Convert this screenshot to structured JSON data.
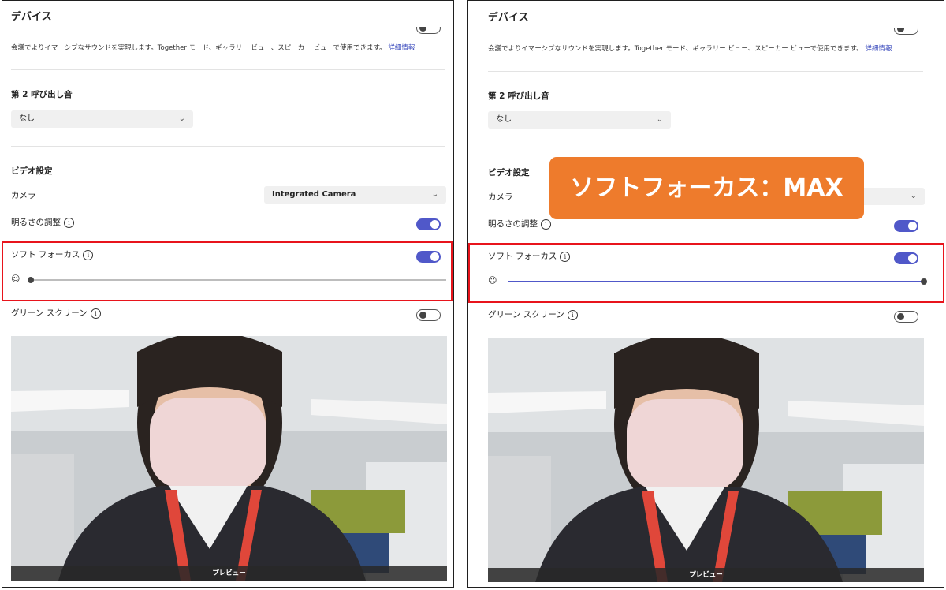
{
  "panels": [
    {
      "header_title": "デバイス",
      "description": "会議でよりイマーシブなサウンドを実現します。Together モード、ギャラリー ビュー、スピーカー ビューで使用できます。",
      "more_info_link": "詳細情報",
      "second_ringer_label": "第 2 呼び出し音",
      "second_ringer_value": "なし",
      "video_settings_label": "ビデオ設定",
      "camera_label": "カメラ",
      "camera_value": "Integrated Camera",
      "brightness_label": "明るさの調整",
      "brightness_toggle": true,
      "soft_focus_label": "ソフト フォーカス",
      "soft_focus_toggle": true,
      "soft_focus_level": 0,
      "green_screen_label": "グリーン スクリーン",
      "green_screen_toggle": false,
      "preview_label": "プレビュー"
    },
    {
      "header_title": "デバイス",
      "description": "会議でよりイマーシブなサウンドを実現します。Together モード、ギャラリー ビュー、スピーカー ビューで使用できます。",
      "more_info_link": "詳細情報",
      "second_ringer_label": "第 2 呼び出し音",
      "second_ringer_value": "なし",
      "video_settings_label": "ビデオ設定",
      "camera_label": "カメラ",
      "camera_value": "",
      "brightness_label": "明るさの調整",
      "brightness_toggle": true,
      "soft_focus_label": "ソフト フォーカス",
      "soft_focus_toggle": true,
      "soft_focus_level": 1,
      "green_screen_label": "グリーン スクリーン",
      "green_screen_toggle": false,
      "preview_label": "プレビュー"
    }
  ],
  "callout": {
    "text": "ソフトフォーカス：MAX",
    "color": "#ee7b2c"
  },
  "colors": {
    "accent": "#5058c9",
    "highlight": "#e8141c"
  },
  "icons": {
    "chevron": "chevron-down-icon",
    "info": "info-icon",
    "face": "face-retouch-icon"
  }
}
